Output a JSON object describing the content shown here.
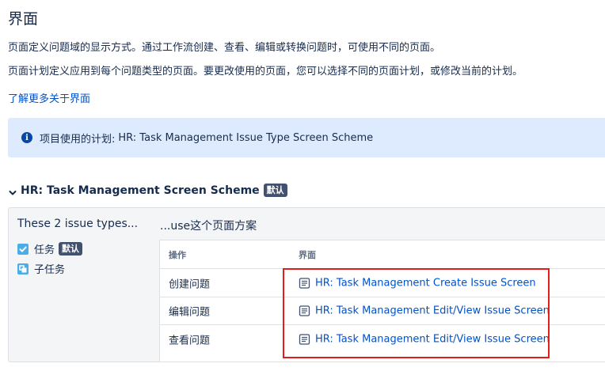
{
  "page": {
    "title": "界面",
    "desc1": "页面定义问题域的显示方式。通过工作流创建、查看、编辑或转换问题时，可使用不同的页面。",
    "desc2": "页面计划定义应用到每个问题类型的页面。要更改使用的页面，您可以选择不同的页面计划，或修改当前的计划。",
    "learn_more": "了解更多关于界面"
  },
  "info": {
    "icon": "info-icon",
    "label": "项目使用的计划:",
    "value": "HR: Task Management Issue Type Screen Scheme"
  },
  "scheme": {
    "name": "HR: Task Management Screen Scheme",
    "default_badge": "默认",
    "types_heading": "These 2 issue types...",
    "use_heading": "...use这个页面方案",
    "issue_types": [
      {
        "label": "任务",
        "icon": "task-checkbox-icon",
        "badge": "默认",
        "color": "#4bade8"
      },
      {
        "label": "子任务",
        "icon": "subtask-icon",
        "color": "#4bade8"
      }
    ],
    "table": {
      "col_operation": "操作",
      "col_screen": "界面",
      "rows": [
        {
          "operation": "创建问题",
          "screen": "HR: Task Management Create Issue Screen"
        },
        {
          "operation": "编辑问题",
          "screen": "HR: Task Management Edit/View Issue Screen"
        },
        {
          "operation": "查看问题",
          "screen": "HR: Task Management Edit/View Issue Screen"
        }
      ]
    }
  },
  "colors": {
    "link": "#0052cc",
    "info_bg": "#deebff",
    "lozenge_bg": "#42526e",
    "highlight_box": "#e01e1e"
  }
}
